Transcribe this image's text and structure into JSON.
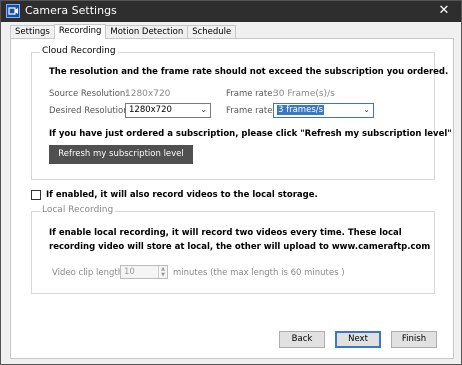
{
  "window": {
    "title": "Camera Settings",
    "close_glyph": "✕"
  },
  "tabs": [
    {
      "label": "Settings"
    },
    {
      "label": "Recording"
    },
    {
      "label": "Motion Detection"
    },
    {
      "label": "Schedule"
    }
  ],
  "cloud": {
    "group_title": "Cloud  Recording",
    "notice": "The resolution and the frame rate should not exceed the subscription you ordered.",
    "source_resolution_label": "Source Resolution:",
    "source_resolution_value": "1280x720",
    "source_frame_rate_label": "Frame rate:",
    "source_frame_rate_value": "30 Frame(s)/s",
    "desired_resolution_label": "Desired Resolution:",
    "desired_resolution_value": "1280x720",
    "frame_rate_label": "Frame rate:",
    "frame_rate_value": "3 frames/s",
    "refresh_hint": "If you have just ordered a subscription, please click \"Refresh my subscription level\"",
    "refresh_button": "Refresh my subscription level"
  },
  "local_checkbox_label": "If enabled, it will also record videos to the local storage.",
  "local": {
    "group_title": "Local  Recording",
    "line1": "If enable local recording, it will record two videos every time. These local",
    "line2": "recording video will store at local, the other will upload to www.cameraftp.com",
    "clip_label": "Video clip length:",
    "clip_value": "10",
    "clip_suffix": "minutes (the max length is 60 minutes )"
  },
  "footer": {
    "back": "Back",
    "next": "Next",
    "finish": "Finish"
  }
}
